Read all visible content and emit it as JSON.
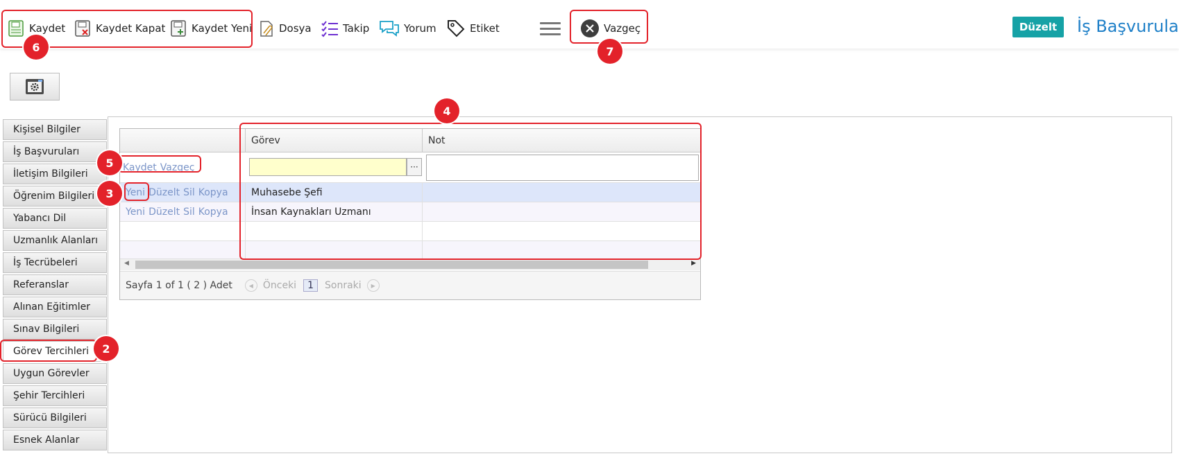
{
  "toolbar": {
    "kaydet": "Kaydet",
    "kaydet_kapat": "Kaydet Kapat",
    "kaydet_yeni": "Kaydet Yeni",
    "dosya": "Dosya",
    "takip": "Takip",
    "yorum": "Yorum",
    "etiket": "Etiket",
    "vazgec": "Vazgeç",
    "duzelt": "Düzelt",
    "title": "İş Başvuruları"
  },
  "tabs": [
    "Kişisel Bilgiler",
    "İş Başvuruları",
    "İletişim Bilgileri",
    "Öğrenim Bilgileri",
    "Yabancı Dil",
    "Uzmanlık Alanları",
    "İş Tecrübeleri",
    "Referanslar",
    "Alınan Eğitimler",
    "Sınav Bilgileri",
    "Görev Tercihleri",
    "Uygun Görevler",
    "Şehir Tercihleri",
    "Sürücü Bilgileri",
    "Esnek Alanlar"
  ],
  "active_tab": "Görev Tercihleri",
  "grid": {
    "headers": {
      "gorev": "Görev",
      "not": "Not"
    },
    "edit_row": {
      "kaydet": "Kaydet",
      "vazgec": "Vazgeç",
      "ellipsis": "···"
    },
    "row_actions": {
      "yeni": "Yeni",
      "duzelt": "Düzelt",
      "sil": "Sil",
      "kopya": "Kopya"
    },
    "rows": [
      {
        "gorev": "Muhasebe Şefi",
        "not": ""
      },
      {
        "gorev": "İnsan Kaynakları Uzmanı",
        "not": ""
      }
    ],
    "pager": {
      "info": "Sayfa 1 of 1 ( 2 ) Adet",
      "prev": "Önceki",
      "page": "1",
      "next": "Sonraki"
    }
  },
  "badges": [
    "2",
    "3",
    "4",
    "5",
    "6",
    "7"
  ],
  "colors": {
    "accent": "#16a2a6",
    "title": "#1f80c8",
    "annotation": "#e3222a",
    "link": "#7b95c8"
  }
}
